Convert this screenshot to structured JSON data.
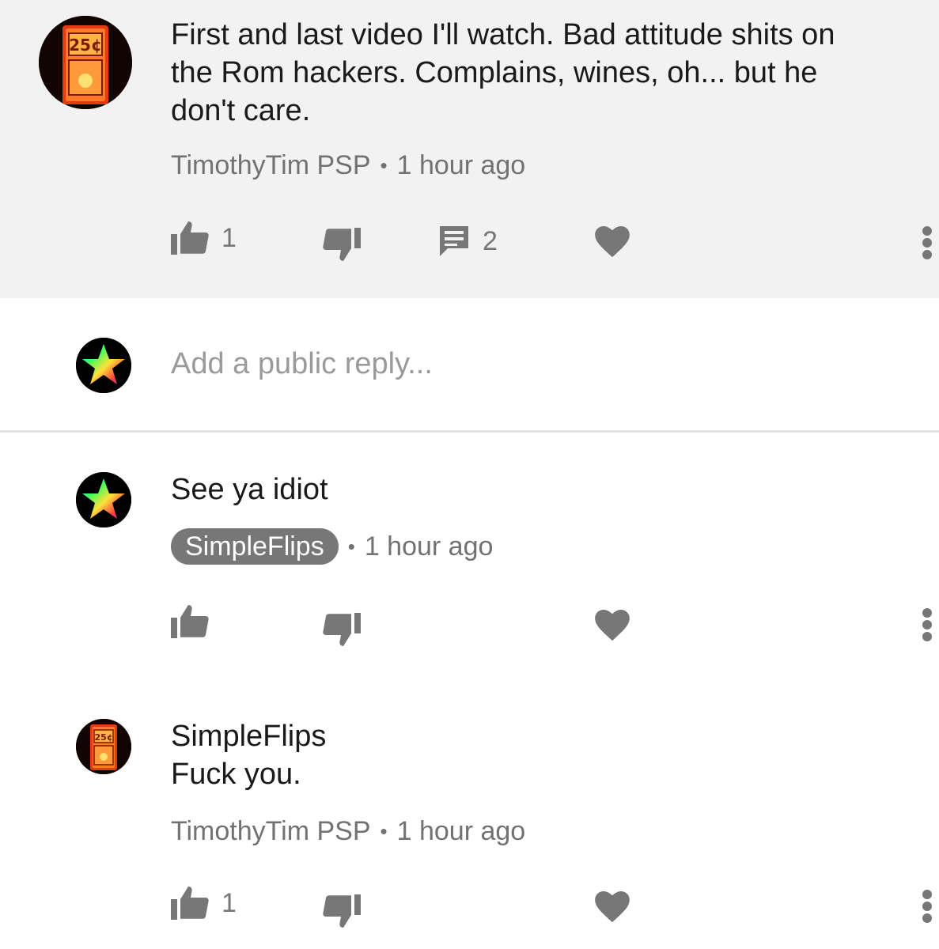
{
  "comment": {
    "text": "First and last video I'll watch. Bad attitude shits on\nthe Rom hackers. Complains, wines, oh... but he\ndon't care.",
    "author": "TimothyTim PSP",
    "time": "1 hour ago",
    "likes": "1",
    "replies": "2",
    "avatar_icon": "coin-slot-25c-avatar"
  },
  "reply_box": {
    "placeholder": "Add a public reply...",
    "avatar_icon": "rainbow-star-avatar"
  },
  "replies": [
    {
      "text": "See ya idiot",
      "author": "SimpleFlips",
      "author_is_creator": true,
      "time": "1 hour ago",
      "likes": "",
      "avatar_icon": "rainbow-star-avatar"
    },
    {
      "mention": "SimpleFlips",
      "text": "Fuck you.",
      "author": "TimothyTim PSP",
      "time": "1 hour ago",
      "likes": "1",
      "avatar_icon": "coin-slot-25c-avatar"
    }
  ],
  "coin_label": "25¢",
  "colors": {
    "top_background": "#f2f2f2",
    "icon_gray": "#777777",
    "creator_chip": "#777777",
    "coin_orange": "#ff5a1f"
  }
}
